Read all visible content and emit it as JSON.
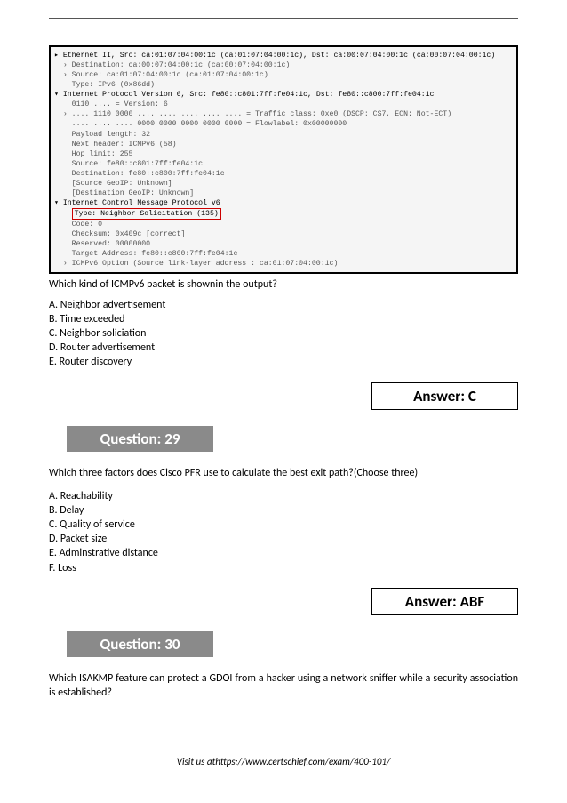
{
  "packet": {
    "l1": "▸ Ethernet II, Src: ca:01:07:04:00:1c (ca:01:07:04:00:1c), Dst: ca:00:07:04:00:1c (ca:00:07:04:00:1c)",
    "l2": "  › Destination: ca:00:07:04:00:1c (ca:00:07:04:00:1c)",
    "l3": "  › Source: ca:01:07:04:00:1c (ca:01:07:04:00:1c)",
    "l4": "    Type: IPv6 (0x86dd)",
    "l5": "▾ Internet Protocol Version 6, Src: fe80::c801:7ff:fe04:1c, Dst: fe80::c800:7ff:fe04:1c",
    "l6": "    0110 .... = Version: 6",
    "l7": "  › .... 1110 0000 .... .... .... .... .... = Traffic class: 0xe0 (DSCP: CS7, ECN: Not-ECT)",
    "l8": "    .... .... .... 0000 0000 0000 0000 0000 = Flowlabel: 0x00000000",
    "l9": "    Payload length: 32",
    "l10": "    Next header: ICMPv6 (58)",
    "l11": "    Hop limit: 255",
    "l12": "    Source: fe80::c801:7ff:fe04:1c",
    "l13": "    Destination: fe80::c800:7ff:fe04:1c",
    "l14": "    [Source GeoIP: Unknown]",
    "l15": "    [Destination GeoIP: Unknown]",
    "l16": "▾ Internet Control Message Protocol v6",
    "l17_pre": "    ",
    "l17_box": "Type: Neighbor Solicitation (135)",
    "l18": "    Code: 0",
    "l19": "    Checksum: 0x409c [correct]",
    "l20": "    Reserved: 00000000",
    "l21": "    Target Address: fe80::c800:7ff:fe04:1c",
    "l22": "  › ICMPv6 Option (Source link-layer address : ca:01:07:04:00:1c)"
  },
  "q28": {
    "prompt": "Which kind of ICMPv6 packet is shownin the output?",
    "a": "A. Neighbor advertisement",
    "b": "B. Time exceeded",
    "c": "C. Neighbor soliciation",
    "d": "D. Router advertisement",
    "e": "E. Router discovery",
    "answer": "Answer: C"
  },
  "q29": {
    "banner": "Question: 29",
    "prompt": "Which three factors does Cisco PFR use to calculate the best exit path?(Choose three)",
    "a": "A. Reachability",
    "b": "B. Delay",
    "c": "C. Quality of service",
    "d": "D. Packet size",
    "e": "E. Adminstrative distance",
    "f": "F. Loss",
    "answer": "Answer: ABF"
  },
  "q30": {
    "banner": "Question: 30",
    "prompt": "Which ISAKMP feature can protect a GDOI from a hacker using a network sniffer while a security association is established?"
  },
  "footer": "Visit us athttps://www.certschief.com/exam/400-101/"
}
